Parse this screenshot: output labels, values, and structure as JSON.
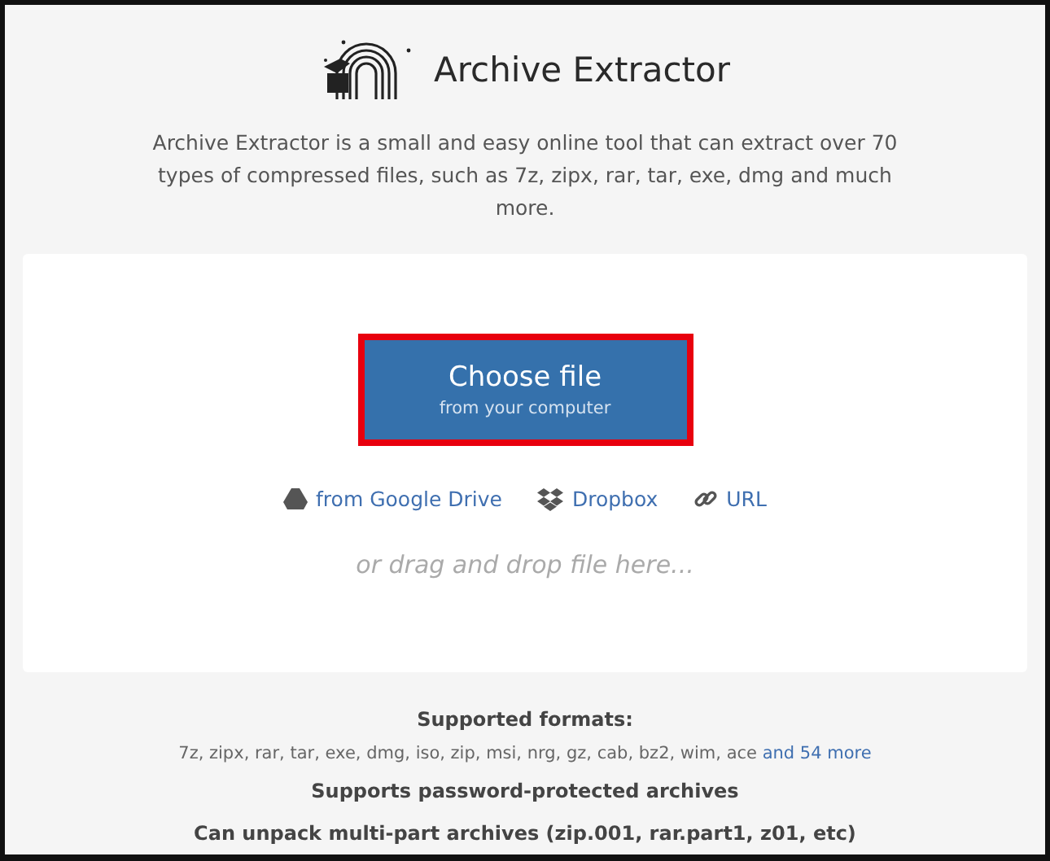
{
  "header": {
    "title": "Archive Extractor",
    "description": "Archive Extractor is a small and easy online tool that can extract over 70 types of compressed files, such as 7z, zipx, rar, tar, exe, dmg and much more."
  },
  "upload": {
    "button": {
      "label": "Choose file",
      "sublabel": "from your computer",
      "highlighted": true
    },
    "sources": [
      {
        "kind": "drive",
        "label": "from Google Drive"
      },
      {
        "kind": "dropbox",
        "label": "Dropbox"
      },
      {
        "kind": "url",
        "label": "URL"
      }
    ],
    "drop_hint": "or drag and drop file here..."
  },
  "info": {
    "formats_heading": "Supported formats:",
    "formats_list": "7z, zipx, rar, tar, exe, dmg, iso, zip, msi, nrg, gz, cab, bz2, wim, ace",
    "formats_more_link": "and 54 more",
    "password_note": "Supports password-protected archives",
    "multipart_note": "Can unpack multi-part archives (zip.001, rar.part1, z01, etc)"
  }
}
